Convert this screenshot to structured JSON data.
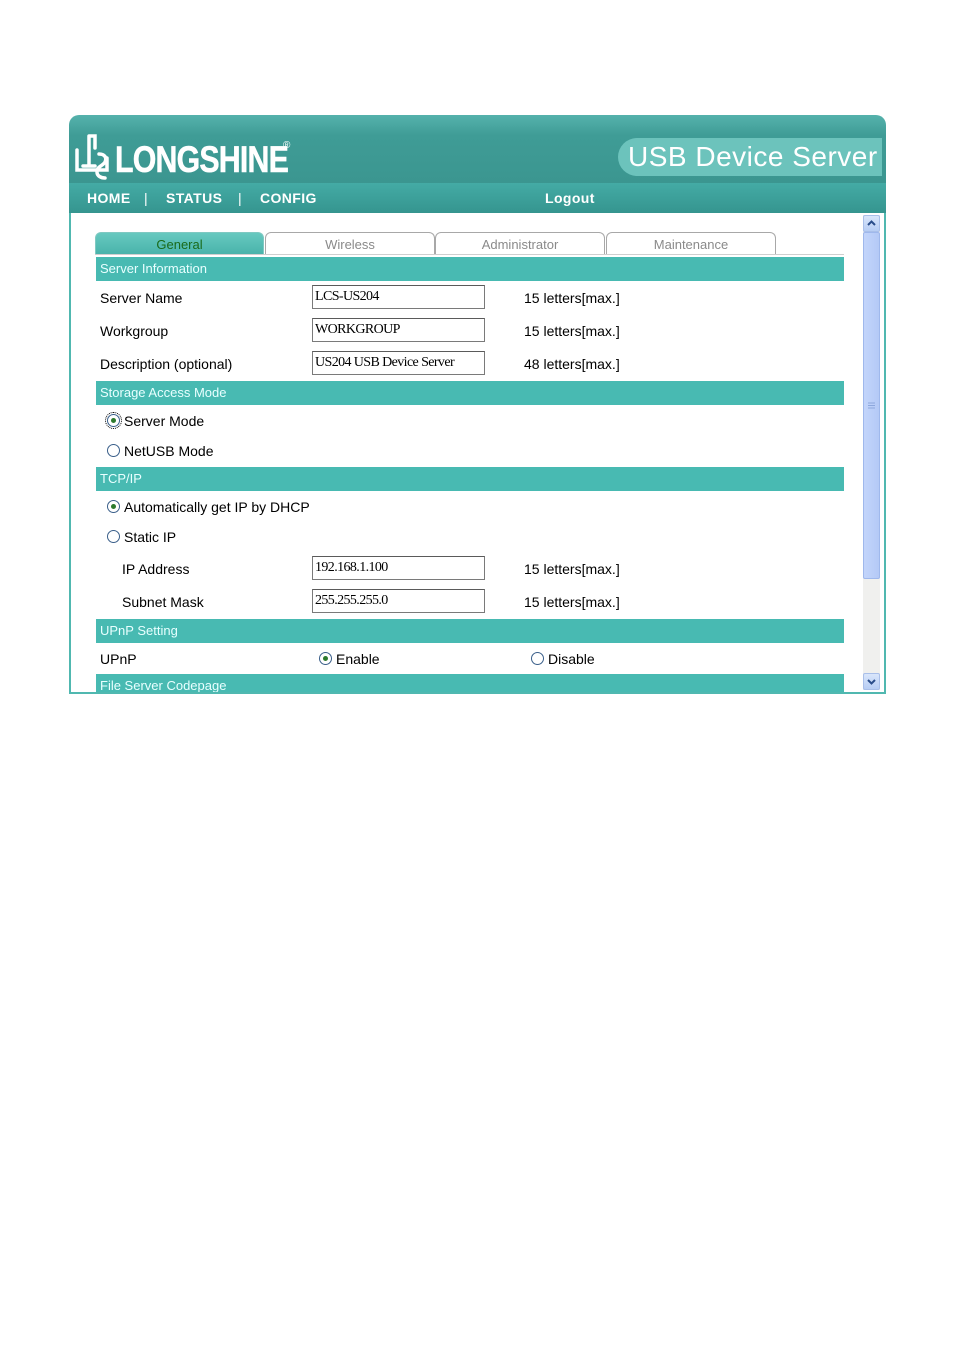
{
  "header": {
    "brand": "LONGSHINE",
    "brand_mark": "®",
    "product": "USB Device Server"
  },
  "nav": {
    "home": "HOME",
    "sep1": "|",
    "status": "STATUS",
    "sep2": "|",
    "config": "CONFIG",
    "logout": "Logout"
  },
  "tabs": [
    "General",
    "Wireless",
    "Administrator",
    "Maintenance"
  ],
  "active_tab": "General",
  "sections": {
    "server_info": "Server Information",
    "storage": "Storage Access Mode",
    "tcpip": "TCP/IP",
    "upnp": "UPnP Setting",
    "codepage": "File Server Codepage"
  },
  "server_info": {
    "server_name": {
      "label": "Server Name",
      "value": "LCS-US204",
      "hint": "15 letters[max.]"
    },
    "workgroup": {
      "label": "Workgroup",
      "value": "WORKGROUP",
      "hint": "15 letters[max.]"
    },
    "description": {
      "label": "Description (optional)",
      "value": "US204 USB Device Server",
      "hint": "48 letters[max.]"
    }
  },
  "storage": {
    "server_mode": {
      "label": "Server Mode",
      "checked": true
    },
    "netusb_mode": {
      "label": "NetUSB Mode",
      "checked": false
    }
  },
  "tcpip": {
    "dhcp": {
      "label": "Automatically get IP by DHCP",
      "checked": true
    },
    "static": {
      "label": "Static IP",
      "checked": false
    },
    "ip_address": {
      "label": "IP Address",
      "value": "192.168.1.100",
      "hint": "15 letters[max.]"
    },
    "subnet_mask": {
      "label": "Subnet Mask",
      "value": "255.255.255.0",
      "hint": "15 letters[max.]"
    }
  },
  "upnp": {
    "label": "UPnP",
    "enable": {
      "label": "Enable",
      "checked": true
    },
    "disable": {
      "label": "Disable",
      "checked": false
    }
  },
  "colors": {
    "header": "#3f9c96",
    "section_bar": "#48bab2",
    "product_pill": "#6cc3bc"
  }
}
